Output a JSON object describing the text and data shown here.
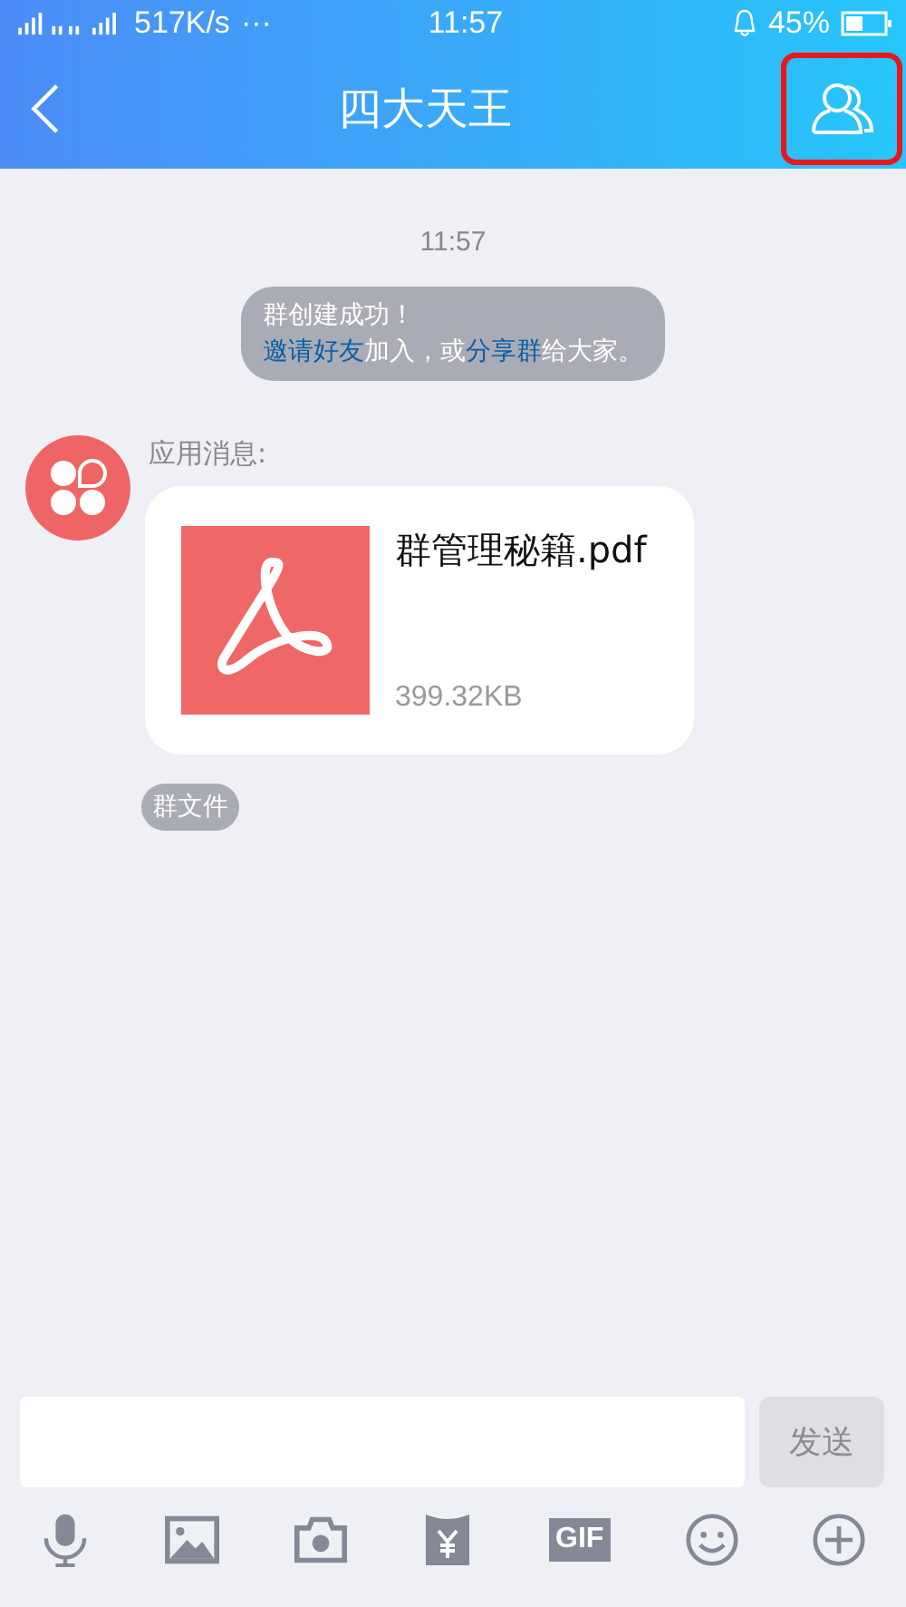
{
  "status_bar": {
    "speed": "517K/s",
    "more": "···",
    "time": "11:57",
    "battery": "45%"
  },
  "nav": {
    "title": "四大天王",
    "members_button_highlighted": true
  },
  "chat": {
    "timestamp": "11:57",
    "system_message": {
      "line_1": "群创建成功！",
      "line_2": [
        {
          "kind": "link",
          "text": "邀请好友"
        },
        {
          "kind": "text",
          "text": "加入，或"
        },
        {
          "kind": "link",
          "text": "分享群"
        },
        {
          "kind": "text",
          "text": "给大家。"
        }
      ]
    },
    "message": {
      "sender": "应用消息:",
      "file_name": "群管理秘籍.pdf",
      "file_size": "399.32KB",
      "tag": "群文件"
    }
  },
  "composer": {
    "send_button": "发送",
    "send_disabled": true,
    "tools": [
      {
        "kind": "mic"
      },
      {
        "kind": "image"
      },
      {
        "kind": "camera"
      },
      {
        "kind": "red-packet"
      },
      {
        "kind": "gif",
        "text": "GIF"
      },
      {
        "kind": "emoji"
      },
      {
        "kind": "plus"
      }
    ]
  }
}
